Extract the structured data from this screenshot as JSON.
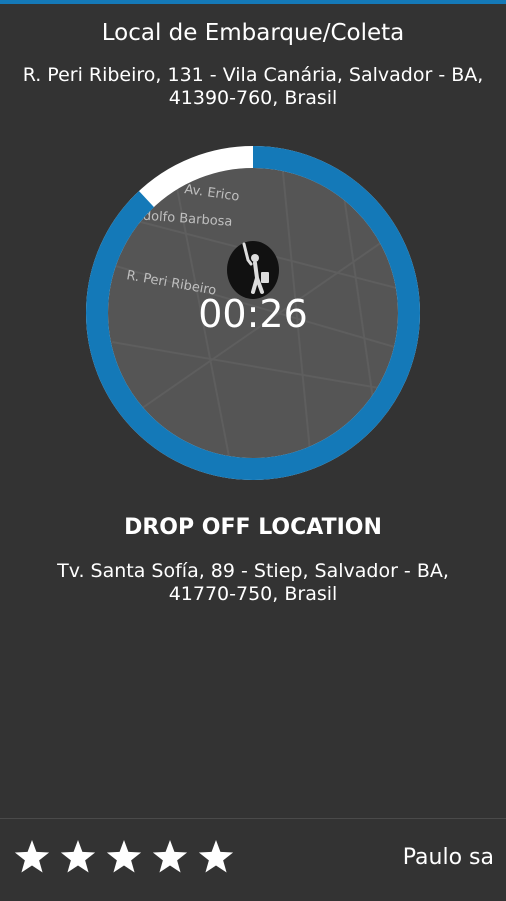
{
  "pickup": {
    "title": "Local de Embarque/Coleta",
    "address_line1": "R. Peri Ribeiro, 131 - Vila Canária, Salvador - BA,",
    "address_line2": "41390-760, Brasil"
  },
  "timer": {
    "countdown": "00:26",
    "progress_remaining": 0.88,
    "accent_color": "#1479b8",
    "track_color": "#ffffff",
    "map_labels": [
      "Av. Erico",
      "Adolfo Barbosa",
      "R. Peri Ribeiro"
    ],
    "icon": "person-hailing-icon"
  },
  "dropoff": {
    "title": "DROP OFF LOCATION",
    "address_line1": "Tv. Santa Sofía, 89 - Stiep, Salvador - BA,",
    "address_line2": "41770-750, Brasil"
  },
  "footer": {
    "rating": 5,
    "rating_max": 5,
    "driver_name": "Paulo sa"
  }
}
